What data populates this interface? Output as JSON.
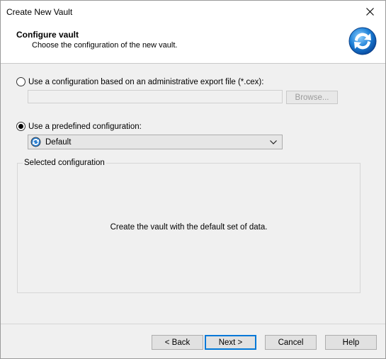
{
  "window": {
    "title": "Create New Vault"
  },
  "header": {
    "title": "Configure vault",
    "subtitle": "Choose the configuration of the new vault.",
    "icon": "vault-sync-icon"
  },
  "options": {
    "export_file": {
      "label": "Use a configuration based on an administrative export file (*.cex):",
      "selected": false,
      "path_value": "",
      "browse_label": "Browse..."
    },
    "predefined": {
      "label": "Use a predefined configuration:",
      "selected": true,
      "selected_value": "Default"
    }
  },
  "selected_configuration": {
    "label": "Selected configuration",
    "description": "Create the vault with the default set of data."
  },
  "buttons": {
    "back": "< Back",
    "next": "Next >",
    "cancel": "Cancel",
    "help": "Help"
  },
  "colors": {
    "accent": "#0078d7",
    "dialog_bg": "#f0f0f0"
  }
}
